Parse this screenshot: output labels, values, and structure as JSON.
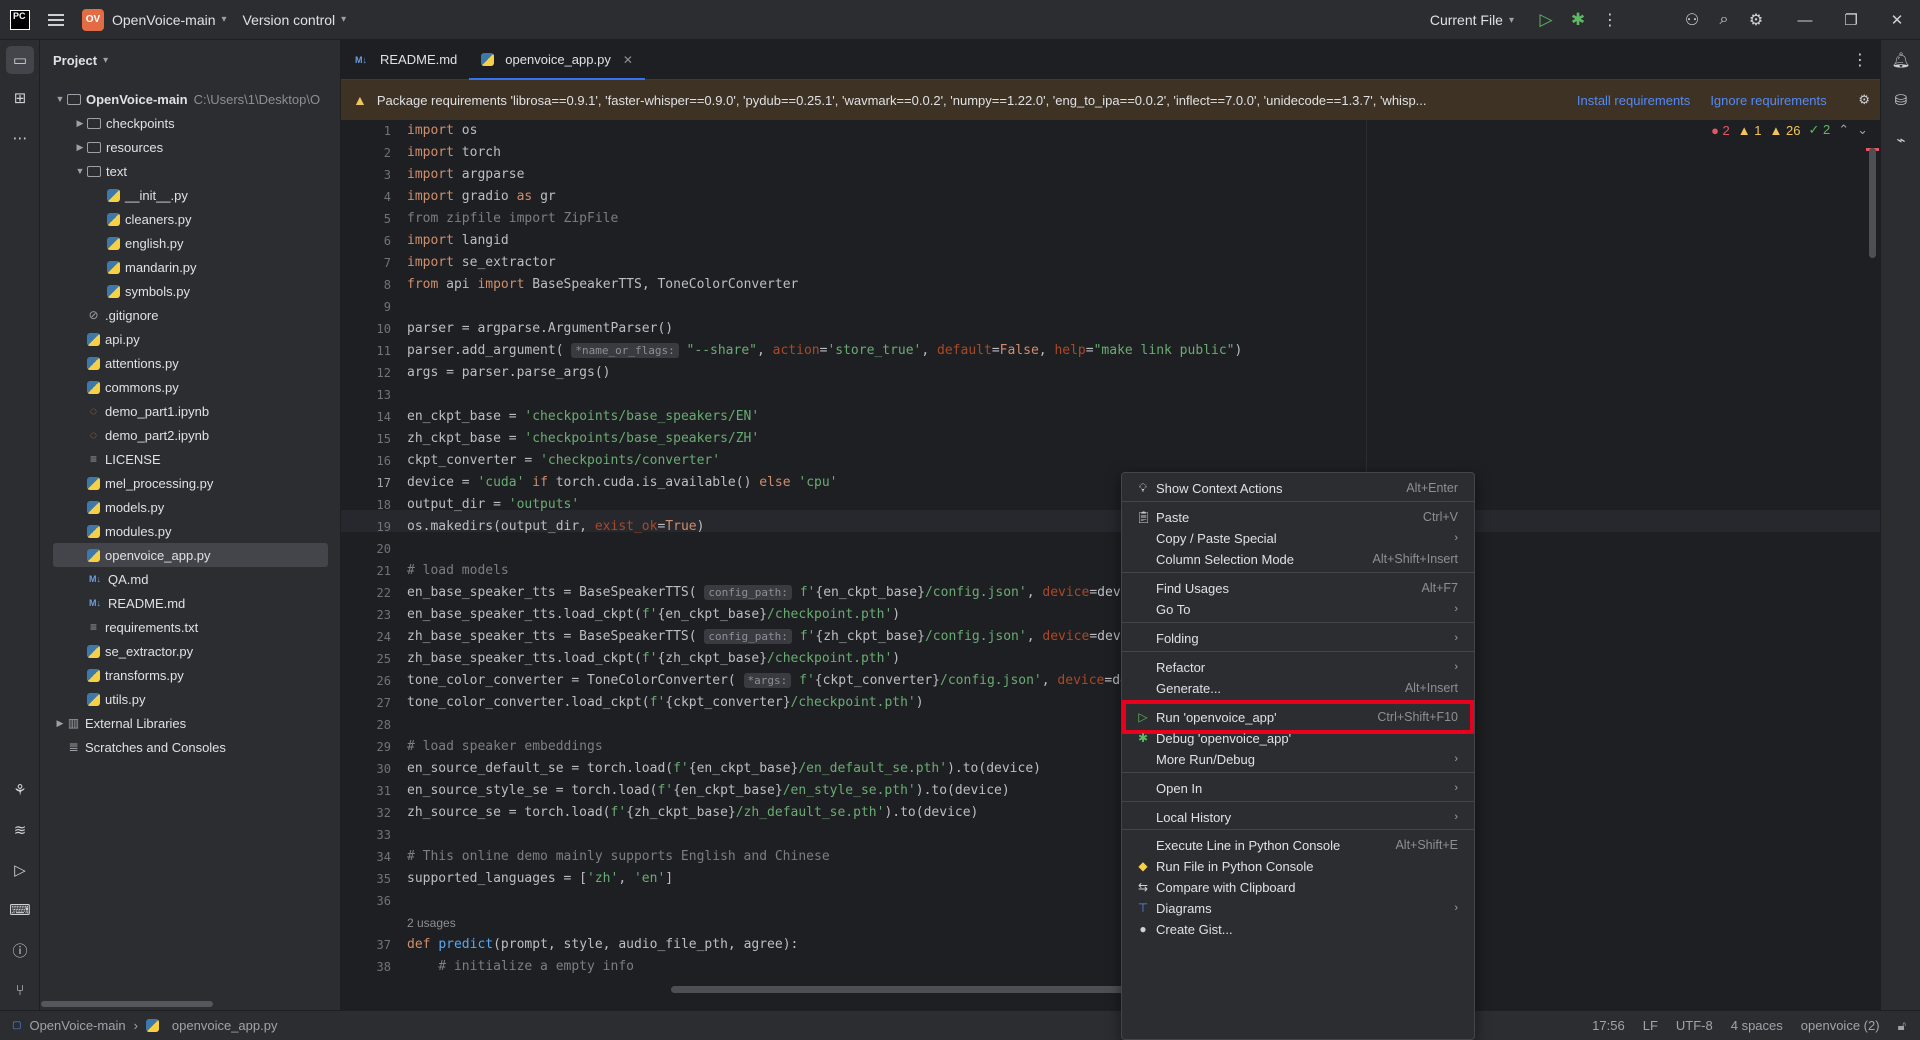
{
  "titlebar": {
    "logo": "PC",
    "project_badge": "OV",
    "project_name": "OpenVoice-main",
    "vcs": "Version control",
    "run_config": "Current File"
  },
  "project_panel": {
    "title": "Project",
    "root": "OpenVoice-main",
    "root_path": "C:\\Users\\1\\Desktop\\O",
    "items": [
      {
        "label": "checkpoints",
        "type": "folder",
        "depth": 1,
        "expanded": false
      },
      {
        "label": "resources",
        "type": "folder",
        "depth": 1,
        "expanded": false
      },
      {
        "label": "text",
        "type": "folder",
        "depth": 1,
        "expanded": true
      },
      {
        "label": "__init__.py",
        "type": "py",
        "depth": 2
      },
      {
        "label": "cleaners.py",
        "type": "py",
        "depth": 2
      },
      {
        "label": "english.py",
        "type": "py",
        "depth": 2
      },
      {
        "label": "mandarin.py",
        "type": "py",
        "depth": 2
      },
      {
        "label": "symbols.py",
        "type": "py",
        "depth": 2
      },
      {
        "label": ".gitignore",
        "type": "ignore",
        "depth": 1
      },
      {
        "label": "api.py",
        "type": "py",
        "depth": 1
      },
      {
        "label": "attentions.py",
        "type": "py",
        "depth": 1
      },
      {
        "label": "commons.py",
        "type": "py",
        "depth": 1
      },
      {
        "label": "demo_part1.ipynb",
        "type": "ipynb",
        "depth": 1
      },
      {
        "label": "demo_part2.ipynb",
        "type": "ipynb",
        "depth": 1
      },
      {
        "label": "LICENSE",
        "type": "txt",
        "depth": 1
      },
      {
        "label": "mel_processing.py",
        "type": "py",
        "depth": 1
      },
      {
        "label": "models.py",
        "type": "py",
        "depth": 1
      },
      {
        "label": "modules.py",
        "type": "py",
        "depth": 1
      },
      {
        "label": "openvoice_app.py",
        "type": "py",
        "depth": 1,
        "selected": true
      },
      {
        "label": "QA.md",
        "type": "md",
        "depth": 1
      },
      {
        "label": "README.md",
        "type": "md",
        "depth": 1
      },
      {
        "label": "requirements.txt",
        "type": "txt",
        "depth": 1
      },
      {
        "label": "se_extractor.py",
        "type": "py",
        "depth": 1
      },
      {
        "label": "transforms.py",
        "type": "py",
        "depth": 1
      },
      {
        "label": "utils.py",
        "type": "py",
        "depth": 1
      }
    ],
    "external_libraries": "External Libraries",
    "scratches": "Scratches and Consoles"
  },
  "tabs": [
    {
      "label": "README.md",
      "icon": "M↓",
      "active": false
    },
    {
      "label": "openvoice_app.py",
      "icon": "py",
      "active": true
    }
  ],
  "banner": {
    "text": "Package requirements 'librosa==0.9.1', 'faster-whisper==0.9.0', 'pydub==0.25.1', 'wavmark==0.0.2', 'numpy==1.22.0', 'eng_to_ipa==0.0.2', 'inflect==7.0.0', 'unidecode==1.3.7', 'whisp...",
    "install": "Install requirements",
    "ignore": "Ignore requirements"
  },
  "problems": {
    "errors": "2",
    "warnings": "1",
    "weak_warnings": "26",
    "ok": "2"
  },
  "editor": {
    "current_line": 17,
    "line_numbers": [
      "1",
      "2",
      "3",
      "4",
      "5",
      "6",
      "7",
      "8",
      "9",
      "10",
      "11",
      "12",
      "13",
      "14",
      "15",
      "16",
      "17",
      "18",
      "19",
      "20",
      "21",
      "22",
      "23",
      "24",
      "25",
      "26",
      "27",
      "28",
      "29",
      "30",
      "31",
      "32",
      "33",
      "34",
      "35",
      "36",
      "",
      "37",
      "38"
    ],
    "usages": "2 usages"
  },
  "context_menu": {
    "items": [
      {
        "label": "Show Context Actions",
        "shortcut": "Alt+Enter",
        "icon": "bulb-icon"
      },
      {
        "label": "Paste",
        "shortcut": "Ctrl+V",
        "icon": "paste-icon"
      },
      {
        "label": "Copy / Paste Special",
        "submenu": true
      },
      {
        "label": "Column Selection Mode",
        "shortcut": "Alt+Shift+Insert"
      },
      {
        "label": "Find Usages",
        "shortcut": "Alt+F7"
      },
      {
        "label": "Go To",
        "submenu": true
      },
      {
        "label": "Folding",
        "submenu": true
      },
      {
        "label": "Refactor",
        "submenu": true
      },
      {
        "label": "Generate...",
        "shortcut": "Alt+Insert"
      },
      {
        "label": "Run 'openvoice_app'",
        "shortcut": "Ctrl+Shift+F10",
        "icon": "run-icon",
        "highlighted": true
      },
      {
        "label": "Debug 'openvoice_app'",
        "icon": "debug-icon"
      },
      {
        "label": "More Run/Debug",
        "submenu": true
      },
      {
        "label": "Open In",
        "submenu": true
      },
      {
        "label": "Local History",
        "submenu": true
      },
      {
        "label": "Execute Line in Python Console",
        "shortcut": "Alt+Shift+E"
      },
      {
        "label": "Run File in Python Console",
        "icon": "python-icon"
      },
      {
        "label": "Compare with Clipboard",
        "icon": "compare-icon"
      },
      {
        "label": "Diagrams",
        "submenu": true,
        "icon": "diagram-icon"
      },
      {
        "label": "Create Gist...",
        "icon": "github-icon"
      }
    ]
  },
  "statusbar": {
    "project": "OpenVoice-main",
    "file": "openvoice_app.py",
    "position": "17:56",
    "line_sep": "LF",
    "encoding": "UTF-8",
    "indent": "4 spaces",
    "interpreter": "openvoice (2)"
  },
  "colors": {
    "accent": "#3574f0",
    "highlight_box": "#e8001c",
    "run_green": "#5fb865",
    "warning": "#f2c55c",
    "error": "#e55765"
  }
}
